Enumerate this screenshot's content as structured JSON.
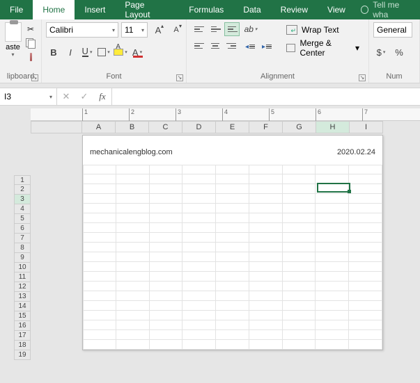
{
  "tabs": {
    "file": "File",
    "home": "Home",
    "insert": "Insert",
    "page_layout": "Page Layout",
    "formulas": "Formulas",
    "data": "Data",
    "review": "Review",
    "view": "View",
    "tell_me": "Tell me wha"
  },
  "ribbon": {
    "clipboard": {
      "label": "lipboard",
      "paste": "aste"
    },
    "font": {
      "label": "Font",
      "name": "Calibri",
      "size": "11",
      "bold": "B",
      "italic": "I",
      "underline": "U",
      "grow": "A",
      "shrink": "A",
      "color_letter": "A"
    },
    "alignment": {
      "label": "Alignment",
      "wrap": "Wrap Text",
      "merge": "Merge & Center"
    },
    "number": {
      "label": "Num",
      "format": "General",
      "currency": "$",
      "percent": "%"
    }
  },
  "formula_bar": {
    "name_box": "I3",
    "cancel": "✕",
    "enter": "✓",
    "fx": "fx",
    "value": ""
  },
  "ruler_ticks": [
    "1",
    "2",
    "3",
    "4",
    "5",
    "6",
    "7"
  ],
  "columns": [
    "A",
    "B",
    "C",
    "D",
    "E",
    "F",
    "G",
    "H",
    "I"
  ],
  "selected_col": "H",
  "rows": [
    "1",
    "2",
    "3",
    "4",
    "5",
    "6",
    "7",
    "8",
    "9",
    "10",
    "11",
    "12",
    "13",
    "14",
    "15",
    "16",
    "17",
    "18",
    "19"
  ],
  "selected_row": "3",
  "page_header": {
    "left": "mechanicalengblog.com",
    "right": "2020.02.24"
  },
  "active_cell": {
    "col_index": 7,
    "row_index": 2
  }
}
